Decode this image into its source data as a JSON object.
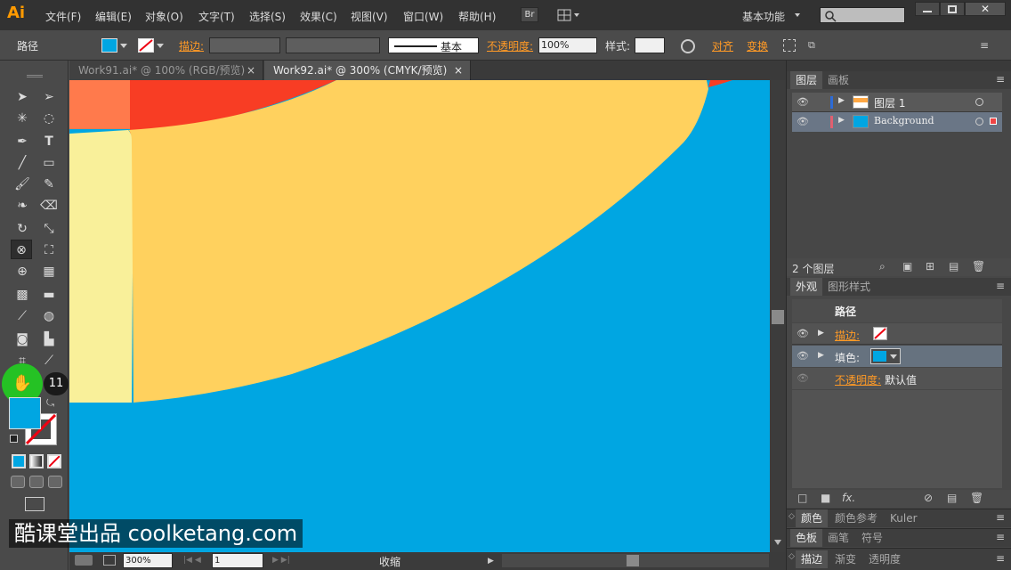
{
  "app": {
    "logo": "Ai"
  },
  "menu": [
    "文件(F)",
    "编辑(E)",
    "对象(O)",
    "文字(T)",
    "选择(S)",
    "效果(C)",
    "视图(V)",
    "窗口(W)",
    "帮助(H)"
  ],
  "bridge_label": "Br",
  "workspace": "基本功能",
  "control": {
    "selection_label": "路径",
    "stroke_label": "描边:",
    "brush_label": "基本",
    "opacity_label": "不透明度:",
    "opacity_value": "100%",
    "style_label": "样式:",
    "align_label": "对齐",
    "transform_label": "变换"
  },
  "tabs": [
    "Work91.ai* @ 100% (RGB/预览)",
    "Work92.ai* @ 300% (CMYK/预览)"
  ],
  "tool_badge": "11",
  "status": {
    "zoom": "300%",
    "page": "1",
    "mode": "收缩"
  },
  "layers": {
    "tabs": [
      "图层",
      "画板"
    ],
    "items": [
      {
        "name": "图层 1",
        "color": "#2d6bd6"
      },
      {
        "name": "Background",
        "color": "#e06070"
      }
    ],
    "count": "2 个图层"
  },
  "appearance": {
    "tabs": [
      "外观",
      "图形样式"
    ],
    "title": "路径",
    "stroke_label": "描边:",
    "fill_label": "填色:",
    "opacity_label": "不透明度:",
    "opacity_value": "默认值"
  },
  "bottom_panels": [
    [
      "颜色",
      "颜色参考",
      "Kuler"
    ],
    [
      "色板",
      "画笔",
      "符号"
    ],
    [
      "描边",
      "渐变",
      "透明度"
    ]
  ],
  "watermark": {
    "cn": "酷课堂出品",
    "url": "coolketang.com"
  },
  "colors": {
    "canvas_blue": "#00a6e2",
    "yellow": "#ffd15e",
    "red": "#f83d24",
    "orange": "#ff7a4c",
    "pale": "#f9f09a",
    "accent_orange": "#ff9a26"
  }
}
